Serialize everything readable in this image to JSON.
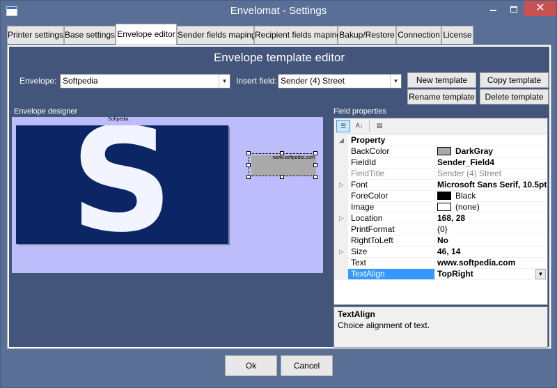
{
  "window": {
    "title": "Envelomat - Settings",
    "close_glyph": "✕"
  },
  "tabs": [
    {
      "label": "Printer settings"
    },
    {
      "label": "Base settings"
    },
    {
      "label": "Envelope editor"
    },
    {
      "label": "Sender fields maping"
    },
    {
      "label": "Recipient fields maping"
    },
    {
      "label": "Bakup/Restore"
    },
    {
      "label": "Connection"
    },
    {
      "label": "License"
    }
  ],
  "active_tab": "Envelope editor",
  "editor": {
    "title": "Envelope template editor",
    "envelope_label": "Envelope:",
    "envelope_value": "Softpedia",
    "insert_field_label": "Insert field:",
    "insert_field_value": "Sender (4) Street",
    "buttons": {
      "new_template": "New template",
      "copy_template": "Copy template",
      "rename_template": "Rename template",
      "delete_template": "Delete template"
    }
  },
  "designer": {
    "label": "Envelope designer",
    "logo_caption": "Softpedia",
    "logo_letter": "S",
    "field_text": "www.softpedia.com",
    "background_color": "#bdbdfb"
  },
  "properties": {
    "label": "Field properties",
    "category": "Property",
    "rows": [
      {
        "name": "BackColor",
        "value": "DarkGray",
        "swatch": "#a9a9a9",
        "bold": true
      },
      {
        "name": "FieldId",
        "value": "Sender_Field4",
        "bold": true
      },
      {
        "name": "FieldTitle",
        "value": "Sender (4) Street",
        "dim": true
      },
      {
        "name": "Font",
        "value": "Microsoft Sans Serif, 10.5pt",
        "bold": true,
        "expandable": true
      },
      {
        "name": "ForeColor",
        "value": "Black",
        "swatch": "#000000"
      },
      {
        "name": "Image",
        "value": "(none)",
        "swatch": "#ffffff"
      },
      {
        "name": "Location",
        "value": "168, 28",
        "bold": true,
        "expandable": true
      },
      {
        "name": "PrintFormat",
        "value": "{0}"
      },
      {
        "name": "RightToLeft",
        "value": "No",
        "bold": true
      },
      {
        "name": "Size",
        "value": "46, 14",
        "bold": true,
        "expandable": true
      },
      {
        "name": "Text",
        "value": "www.softpedia.com",
        "bold": true
      },
      {
        "name": "TextAlign",
        "value": "TopRight",
        "bold": true,
        "selected": true
      }
    ],
    "help_title": "TextAlign",
    "help_description": "Choice alignment of text."
  },
  "footer": {
    "ok": "Ok",
    "cancel": "Cancel"
  }
}
